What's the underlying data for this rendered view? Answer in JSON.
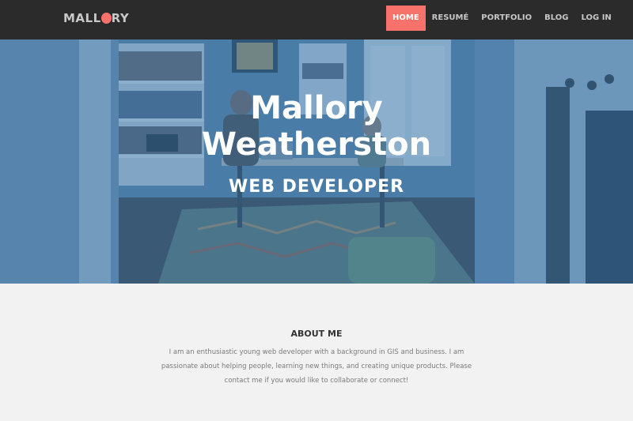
{
  "brand": {
    "logo_before": "MALL",
    "logo_after": "RY",
    "accent_color": "#f7726a"
  },
  "nav": {
    "items": [
      {
        "label": "HOME",
        "active": true
      },
      {
        "label": "RESUMÉ",
        "active": false
      },
      {
        "label": "PORTFOLIO",
        "active": false
      },
      {
        "label": "BLOG",
        "active": false
      },
      {
        "label": "LOG IN",
        "active": false
      }
    ]
  },
  "hero": {
    "name_line1": "Mallory",
    "name_line2": "Weatherston",
    "role": "WEB DEVELOPER"
  },
  "about": {
    "title": "ABOUT ME",
    "text": "I am an enthusiastic young web developer with a background in GIS and business. I am passionate about helping people, learning new things, and creating unique products. Please contact me if you would like to collaborate or connect!"
  }
}
